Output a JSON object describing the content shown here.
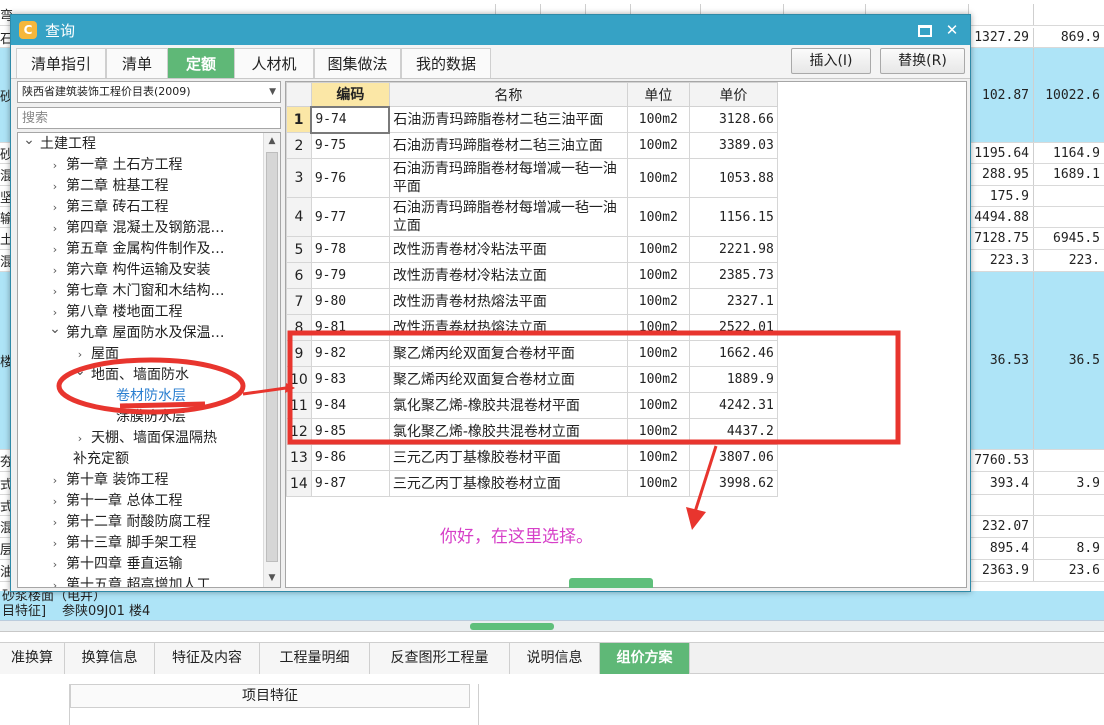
{
  "background": {
    "rows": [
      {
        "left": "弯",
        "c1": "",
        "c2": "",
        "blue": false
      },
      {
        "left": "石",
        "c1": "1327.29",
        "c2": "869.9",
        "blue": false
      },
      {
        "left": "砂",
        "c1": "102.87",
        "c2": "10022.6",
        "blue": true
      },
      {
        "left": "砂",
        "c1": "1195.64",
        "c2": "1164.9",
        "blue": false
      },
      {
        "left": "混",
        "c1": "288.95",
        "c2": "1689.1",
        "blue": false
      },
      {
        "left": "坚",
        "c1": "175.9",
        "c2": "",
        "blue": false
      },
      {
        "left": "输",
        "c1": "4494.88",
        "c2": "",
        "blue": false
      },
      {
        "left": "土",
        "c1": "7128.75",
        "c2": "6945.5",
        "blue": false
      },
      {
        "left": "混",
        "c1": "223.3",
        "c2": "223.",
        "blue": false
      },
      {
        "left": "楼",
        "c1": "36.53",
        "c2": "36.5",
        "blue": true
      },
      {
        "left": "夯",
        "c1": "7760.53",
        "c2": "",
        "blue": false
      },
      {
        "left": "式",
        "c1": "393.4",
        "c2": "3.9",
        "blue": false
      },
      {
        "left": "式",
        "c1": "",
        "c2": "",
        "blue": false
      },
      {
        "left": "混",
        "c1": "232.07",
        "c2": "",
        "blue": false
      },
      {
        "left": "层",
        "c1": "895.4",
        "c2": "8.9",
        "blue": false
      },
      {
        "left": "油",
        "c1": "2363.9",
        "c2": "23.6",
        "blue": false
      }
    ],
    "bottom_row_a": "砂浆楼面（电井）",
    "bottom_row_b": "目特征]",
    "bottom_row_c": "参陕09J01 楼4"
  },
  "bottom_tabs": [
    {
      "label": "准换算",
      "active": false
    },
    {
      "label": "换算信息",
      "active": false
    },
    {
      "label": "特征及内容",
      "active": false
    },
    {
      "label": "工程量明细",
      "active": false
    },
    {
      "label": "反查图形工程量",
      "active": false
    },
    {
      "label": "说明信息",
      "active": false
    },
    {
      "label": "组价方案",
      "active": true
    }
  ],
  "bottom_area": {
    "feature_header": "项目特征"
  },
  "dialog": {
    "title": "查询",
    "app_icon_glyph": "C",
    "close_glyph": "✕",
    "tabs": [
      {
        "label": "清单指引",
        "active": false
      },
      {
        "label": "清单",
        "active": false
      },
      {
        "label": "定额",
        "active": true
      },
      {
        "label": "人材机",
        "active": false
      },
      {
        "label": "图集做法",
        "active": false
      },
      {
        "label": "我的数据",
        "active": false
      }
    ],
    "insert_button": "插入(I)",
    "replace_button": "替换(R)",
    "library_select": "陕西省建筑装饰工程价目表(2009)",
    "search_placeholder": "搜索",
    "tree": [
      {
        "label": "土建工程",
        "level": 0,
        "arrow": "expanded",
        "link": false
      },
      {
        "label": "第一章 土石方工程",
        "level": 1,
        "arrow": "collapsed",
        "link": false
      },
      {
        "label": "第二章 桩基工程",
        "level": 1,
        "arrow": "collapsed",
        "link": false
      },
      {
        "label": "第三章 砖石工程",
        "level": 1,
        "arrow": "collapsed",
        "link": false
      },
      {
        "label": "第四章 混凝土及钢筋混…",
        "level": 1,
        "arrow": "collapsed",
        "link": false
      },
      {
        "label": "第五章 金属构件制作及…",
        "level": 1,
        "arrow": "collapsed",
        "link": false
      },
      {
        "label": "第六章 构件运输及安装",
        "level": 1,
        "arrow": "collapsed",
        "link": false
      },
      {
        "label": "第七章 木门窗和木结构…",
        "level": 1,
        "arrow": "collapsed",
        "link": false
      },
      {
        "label": "第八章 楼地面工程",
        "level": 1,
        "arrow": "collapsed",
        "link": false
      },
      {
        "label": "第九章 屋面防水及保温…",
        "level": 1,
        "arrow": "expanded",
        "link": false
      },
      {
        "label": "屋面",
        "level": 2,
        "arrow": "collapsed",
        "link": false
      },
      {
        "label": "地面、墙面防水",
        "level": 2,
        "arrow": "expanded",
        "link": false
      },
      {
        "label": "卷材防水层",
        "level": 3,
        "arrow": "none",
        "link": true
      },
      {
        "label": "涂膜防水层",
        "level": 3,
        "arrow": "none",
        "link": false
      },
      {
        "label": "天棚、墙面保温隔热",
        "level": 2,
        "arrow": "collapsed",
        "link": false
      },
      {
        "label": "补充定额",
        "level": 2,
        "arrow": "none",
        "link": false
      },
      {
        "label": "第十章 装饰工程",
        "level": 1,
        "arrow": "collapsed",
        "link": false
      },
      {
        "label": "第十一章 总体工程",
        "level": 1,
        "arrow": "collapsed",
        "link": false
      },
      {
        "label": "第十二章 耐酸防腐工程",
        "level": 1,
        "arrow": "collapsed",
        "link": false
      },
      {
        "label": "第十三章 脚手架工程",
        "level": 1,
        "arrow": "collapsed",
        "link": false
      },
      {
        "label": "第十四章 垂直运输",
        "level": 1,
        "arrow": "collapsed",
        "link": false
      },
      {
        "label": "第十五章 超高增加人工…",
        "level": 1,
        "arrow": "collapsed",
        "link": false
      }
    ],
    "table": {
      "headers": {
        "code": "编码",
        "name": "名称",
        "unit": "单位",
        "price": "单价"
      },
      "rows": [
        {
          "idx": "1",
          "code": "9-74",
          "name": "石油沥青玛蹄脂卷材二毡三油平面",
          "unit": "100m2",
          "price": "3128.66",
          "tall": false
        },
        {
          "idx": "2",
          "code": "9-75",
          "name": "石油沥青玛蹄脂卷材二毡三油立面",
          "unit": "100m2",
          "price": "3389.03",
          "tall": false
        },
        {
          "idx": "3",
          "code": "9-76",
          "name": "石油沥青玛蹄脂卷材每增减一毡一油平面",
          "unit": "100m2",
          "price": "1053.88",
          "tall": true
        },
        {
          "idx": "4",
          "code": "9-77",
          "name": "石油沥青玛蹄脂卷材每增减一毡一油立面",
          "unit": "100m2",
          "price": "1156.15",
          "tall": true
        },
        {
          "idx": "5",
          "code": "9-78",
          "name": "改性沥青卷材冷粘法平面",
          "unit": "100m2",
          "price": "2221.98",
          "tall": false
        },
        {
          "idx": "6",
          "code": "9-79",
          "name": "改性沥青卷材冷粘法立面",
          "unit": "100m2",
          "price": "2385.73",
          "tall": false
        },
        {
          "idx": "7",
          "code": "9-80",
          "name": "改性沥青卷材热熔法平面",
          "unit": "100m2",
          "price": "2327.1",
          "tall": false
        },
        {
          "idx": "8",
          "code": "9-81",
          "name": "改性沥青卷材热熔法立面",
          "unit": "100m2",
          "price": "2522.01",
          "tall": false
        },
        {
          "idx": "9",
          "code": "9-82",
          "name": "聚乙烯丙纶双面复合卷材平面",
          "unit": "100m2",
          "price": "1662.46",
          "tall": false
        },
        {
          "idx": "10",
          "code": "9-83",
          "name": "聚乙烯丙纶双面复合卷材立面",
          "unit": "100m2",
          "price": "1889.9",
          "tall": false
        },
        {
          "idx": "11",
          "code": "9-84",
          "name": "氯化聚乙烯-橡胶共混卷材平面",
          "unit": "100m2",
          "price": "4242.31",
          "tall": false
        },
        {
          "idx": "12",
          "code": "9-85",
          "name": "氯化聚乙烯-橡胶共混卷材立面",
          "unit": "100m2",
          "price": "4437.2",
          "tall": false
        },
        {
          "idx": "13",
          "code": "9-86",
          "name": "三元乙丙丁基橡胶卷材平面",
          "unit": "100m2",
          "price": "3807.06",
          "tall": false
        },
        {
          "idx": "14",
          "code": "9-87",
          "name": "三元乙丙丁基橡胶卷材立面",
          "unit": "100m2",
          "price": "3998.62",
          "tall": false
        }
      ]
    }
  },
  "annotation": {
    "text": "你好，在这里选择。",
    "color": "#d63fc8",
    "mark_color": "#e8352e"
  },
  "colors": {
    "title_bar": "#36a2c5",
    "active_tab": "#5fb877",
    "highlight_header": "#fbe7a6",
    "background_blue_row": "#aee4f7"
  }
}
